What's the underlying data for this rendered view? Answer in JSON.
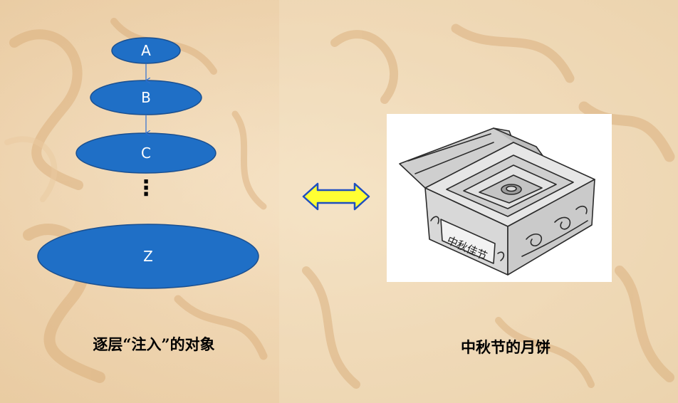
{
  "diagram": {
    "nodes": [
      "A",
      "B",
      "C",
      "Z"
    ],
    "ellipsis": "⋮",
    "caption": "逐层“注入”的对象"
  },
  "illustration": {
    "box_label": "中秋佳节",
    "caption": "中秋节的月饼"
  },
  "colors": {
    "node_fill": "#1f6fc6",
    "node_stroke": "#1a4f8f",
    "arrow_fill": "#ffff33",
    "arrow_stroke": "#1f4fbf"
  }
}
